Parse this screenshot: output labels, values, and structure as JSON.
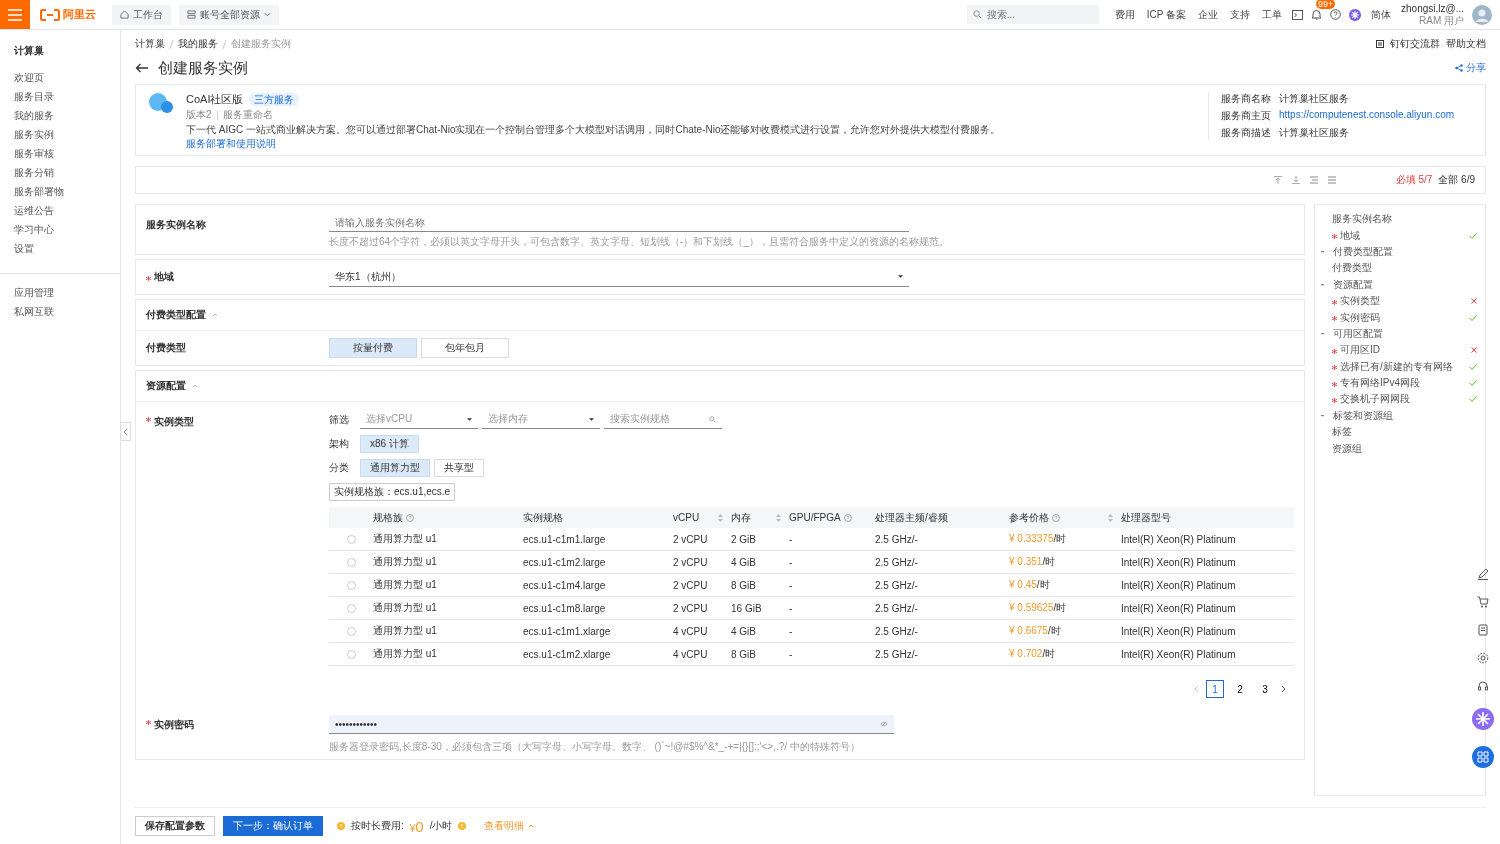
{
  "topbar": {
    "logo": "阿里云",
    "workbench": "工作台",
    "resources": "账号全部资源",
    "search_placeholder": "搜索...",
    "links": [
      "费用",
      "ICP 备案",
      "企业",
      "支持",
      "工单"
    ],
    "badge": "99+",
    "language": "简体",
    "user_name": "zhongsi.lz@...",
    "user_role": "RAM 用户"
  },
  "sidebar": {
    "title": "计算巢",
    "items": [
      "欢迎页",
      "服务目录",
      "我的服务",
      "服务实例",
      "服务审核",
      "服务分销",
      "服务部署物",
      "运维公告",
      "学习中心",
      "设置"
    ],
    "extra_items": [
      "应用管理",
      "私网互联"
    ]
  },
  "breadcrumb": [
    "计算巢",
    "我的服务",
    "创建服务实例"
  ],
  "header_links": [
    "钉钉交流群",
    "帮助文档"
  ],
  "page_title": "创建服务实例",
  "share": "分享",
  "service": {
    "name": "CoAI社区版",
    "tag": "三方服务",
    "meta": [
      "版本2",
      "服务重命名"
    ],
    "description": "下一代 AIGC 一站式商业解决方案。您可以通过部署Chat-Nio实现在一个控制台管理多个大模型对话调用，同时Chate-Nio还能够对收费模式进行设置，允许您对外提供大模型付费服务。",
    "link": "服务部署和使用说明",
    "provider": [
      {
        "label": "服务商名称",
        "value": "计算巢社区服务",
        "kind": "text"
      },
      {
        "label": "服务商主页",
        "value": "https://computenest.console.aliyun.com",
        "kind": "link"
      },
      {
        "label": "服务商描述",
        "value": "计算巢社区服务",
        "kind": "text"
      }
    ]
  },
  "progress": {
    "required": "必填 5/7",
    "all": "全部 6/9"
  },
  "name_field": {
    "label": "服务实例名称",
    "required": false,
    "placeholder": "请输入服务实例名称",
    "hint": "长度不超过64个字符，必须以英文字母开头，可包含数字、英文字母、短划线（-）和下划线（_），且需符合服务中定义的资源的名称规范。"
  },
  "region_field": {
    "label": "地域",
    "required": true,
    "value": "华东1（杭州）"
  },
  "pay_section": {
    "title": "付费类型配置",
    "label": "付费类型",
    "options": [
      {
        "label": "按量付费",
        "selected": true
      },
      {
        "label": "包年包月",
        "selected": false
      }
    ]
  },
  "resource_section": {
    "title": "资源配置",
    "label": "实例类型",
    "required": true,
    "filter_label": "筛选",
    "filters": [
      {
        "placeholder": "选择vCPU",
        "kind": "select"
      },
      {
        "placeholder": "选择内存",
        "kind": "select"
      },
      {
        "placeholder": "搜索实例规格",
        "kind": "search"
      }
    ],
    "arch_label": "架构",
    "arch_options": [
      {
        "label": "x86 计算",
        "selected": true
      }
    ],
    "category_label": "分类",
    "category_options": [
      {
        "label": "通用算力型",
        "selected": true
      },
      {
        "label": "共享型",
        "selected": false
      }
    ],
    "family_tag": "实例规格族：ecs.u1,ecs.e",
    "table": {
      "columns": [
        {
          "label": "规格族",
          "help": true,
          "sortable": false
        },
        {
          "label": "实例规格",
          "help": false,
          "sortable": false
        },
        {
          "label": "vCPU",
          "help": false,
          "sortable": true
        },
        {
          "label": "内存",
          "help": false,
          "sortable": true
        },
        {
          "label": "GPU/FPGA",
          "help": true,
          "sortable": false
        },
        {
          "label": "处理器主频/睿频",
          "help": false,
          "sortable": false
        },
        {
          "label": "参考价格",
          "help": true,
          "sortable": true
        },
        {
          "label": "处理器型号",
          "help": false,
          "sortable": false
        }
      ],
      "rows": [
        {
          "selected": false,
          "cells": [
            "通用算力型 u1",
            "ecs.u1-c1m1.large",
            "2 vCPU",
            "2 GiB",
            "-",
            "2.5 GHz/-"
          ],
          "price": "¥ 0.33375",
          "unit": "/时",
          "cpu": "Intel(R) Xeon(R) Platinum"
        },
        {
          "selected": false,
          "cells": [
            "通用算力型 u1",
            "ecs.u1-c1m2.large",
            "2 vCPU",
            "4 GiB",
            "-",
            "2.5 GHz/-"
          ],
          "price": "¥ 0.351",
          "unit": "/时",
          "cpu": "Intel(R) Xeon(R) Platinum"
        },
        {
          "selected": false,
          "cells": [
            "通用算力型 u1",
            "ecs.u1-c1m4.large",
            "2 vCPU",
            "8 GiB",
            "-",
            "2.5 GHz/-"
          ],
          "price": "¥ 0.45",
          "unit": "/时",
          "cpu": "Intel(R) Xeon(R) Platinum"
        },
        {
          "selected": false,
          "cells": [
            "通用算力型 u1",
            "ecs.u1-c1m8.large",
            "2 vCPU",
            "16 GiB",
            "-",
            "2.5 GHz/-"
          ],
          "price": "¥ 0.59625",
          "unit": "/时",
          "cpu": "Intel(R) Xeon(R) Platinum"
        },
        {
          "selected": false,
          "cells": [
            "通用算力型 u1",
            "ecs.u1-c1m1.xlarge",
            "4 vCPU",
            "4 GiB",
            "-",
            "2.5 GHz/-"
          ],
          "price": "¥ 0.6675",
          "unit": "/时",
          "cpu": "Intel(R) Xeon(R) Platinum"
        },
        {
          "selected": false,
          "cells": [
            "通用算力型 u1",
            "ecs.u1-c1m2.xlarge",
            "4 vCPU",
            "8 GiB",
            "-",
            "2.5 GHz/-"
          ],
          "price": "¥ 0.702",
          "unit": "/时",
          "cpu": "Intel(R) Xeon(R) Platinum"
        }
      ]
    },
    "pages": [
      {
        "label": "1",
        "selected": true
      },
      {
        "label": "2",
        "selected": false
      },
      {
        "label": "3",
        "selected": false
      }
    ],
    "password_label": "实例密码",
    "password_required": true,
    "password_value": "••••••••••••",
    "password_hint": "服务器登录密码,长度8-30，必须包含三项（大写字母、小写字母、数字、 ()`~!@#$%^&*_-+=|{}[]:;'<>,.?/ 中的特殊符号）"
  },
  "nav": [
    {
      "label": "服务实例名称",
      "required": false
    },
    {
      "label": "地域",
      "required": true,
      "valid": true
    },
    {
      "label": "付费类型配置",
      "children": [
        {
          "label": "付费类型",
          "required": false
        }
      ]
    },
    {
      "label": "资源配置",
      "children": [
        {
          "label": "实例类型",
          "required": true,
          "valid": false
        },
        {
          "label": "实例密码",
          "required": true,
          "valid": true
        }
      ]
    },
    {
      "label": "可用区配置",
      "children": [
        {
          "label": "可用区ID",
          "required": true,
          "valid": false
        },
        {
          "label": "选择已有/新建的专有网络",
          "required": true,
          "valid": true
        },
        {
          "label": "专有网络IPv4网段",
          "required": true,
          "valid": true
        },
        {
          "label": "交换机子网网段",
          "required": true,
          "valid": true
        }
      ]
    },
    {
      "label": "标签和资源组",
      "children": [
        {
          "label": "标签",
          "required": false
        },
        {
          "label": "资源组",
          "required": false
        }
      ]
    }
  ],
  "footer": {
    "save": "保存配置参数",
    "next": "下一步：确认订单",
    "fee_label": "按时长费用:",
    "currency": "¥",
    "amount": "0",
    "unit": "/小时",
    "detail": "查看明细"
  }
}
